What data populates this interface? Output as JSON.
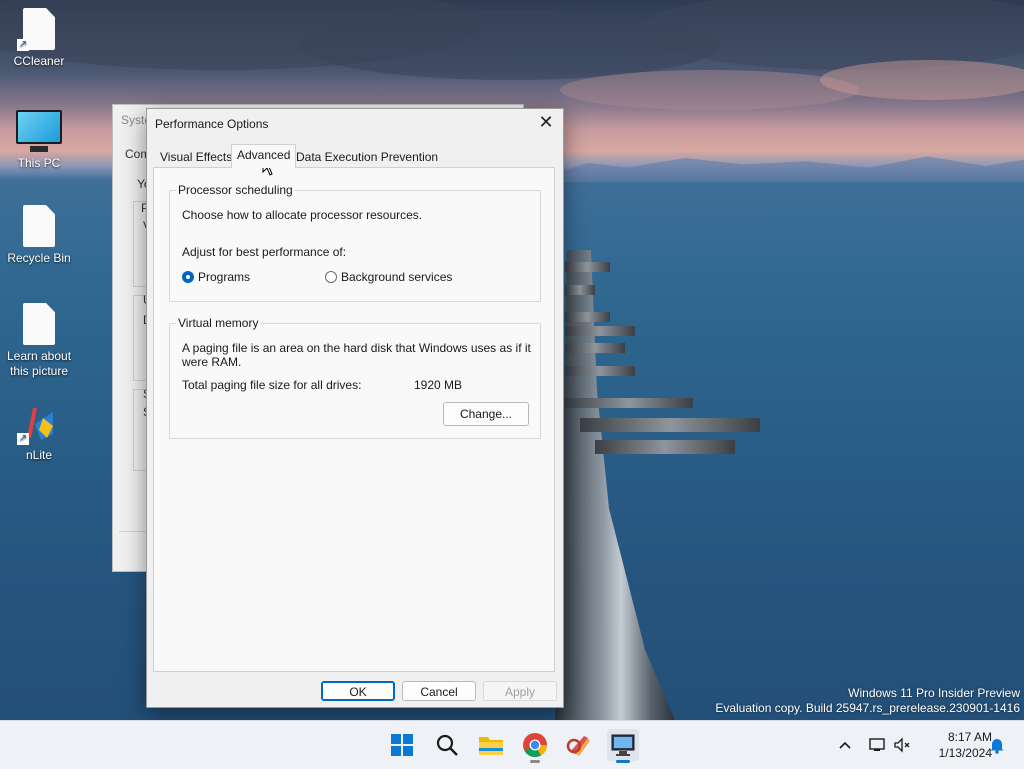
{
  "desktop": {
    "icons": [
      {
        "label": "CCleaner"
      },
      {
        "label": "This PC"
      },
      {
        "label": "Recycle Bin"
      },
      {
        "label": "Learn about this picture"
      },
      {
        "label": "nLite"
      }
    ],
    "watermark": {
      "line1": "Windows 11 Pro Insider Preview",
      "line2": "Evaluation copy. Build 25947.rs_prerelease.230901-1416"
    }
  },
  "background_window": {
    "title": "Syste",
    "fragments": [
      "Com",
      "Yo",
      "P",
      "V",
      "U",
      "D",
      "S",
      "S"
    ]
  },
  "dialog": {
    "title": "Performance Options",
    "tabs": [
      {
        "label": "Visual Effects",
        "selected": false
      },
      {
        "label": "Advanced",
        "selected": true
      },
      {
        "label": "Data Execution Prevention",
        "selected": false
      }
    ],
    "processor_scheduling": {
      "legend": "Processor scheduling",
      "description": "Choose how to allocate processor resources.",
      "adjust_label": "Adjust for best performance of:",
      "options": [
        {
          "label": "Programs",
          "selected": true
        },
        {
          "label": "Background services",
          "selected": false
        }
      ]
    },
    "virtual_memory": {
      "legend": "Virtual memory",
      "description_line1": "A paging file is an area on the hard disk that Windows uses as if it",
      "description_line2": "were RAM.",
      "total_label": "Total paging file size for all drives:",
      "total_value": "1920 MB",
      "change_button": "Change..."
    },
    "buttons": {
      "ok": "OK",
      "cancel": "Cancel",
      "apply": "Apply"
    }
  },
  "taskbar": {
    "apps": [
      "start-icon",
      "search-icon",
      "file-explorer-icon",
      "chrome-icon",
      "ccleaner-icon",
      "system-properties-icon"
    ],
    "clock": {
      "time": "8:17 AM",
      "date": "1/13/2024"
    }
  },
  "colors": {
    "accent": "#0067c0",
    "taskbar": "#eef1f6",
    "dialog": "#f0f0f0"
  }
}
